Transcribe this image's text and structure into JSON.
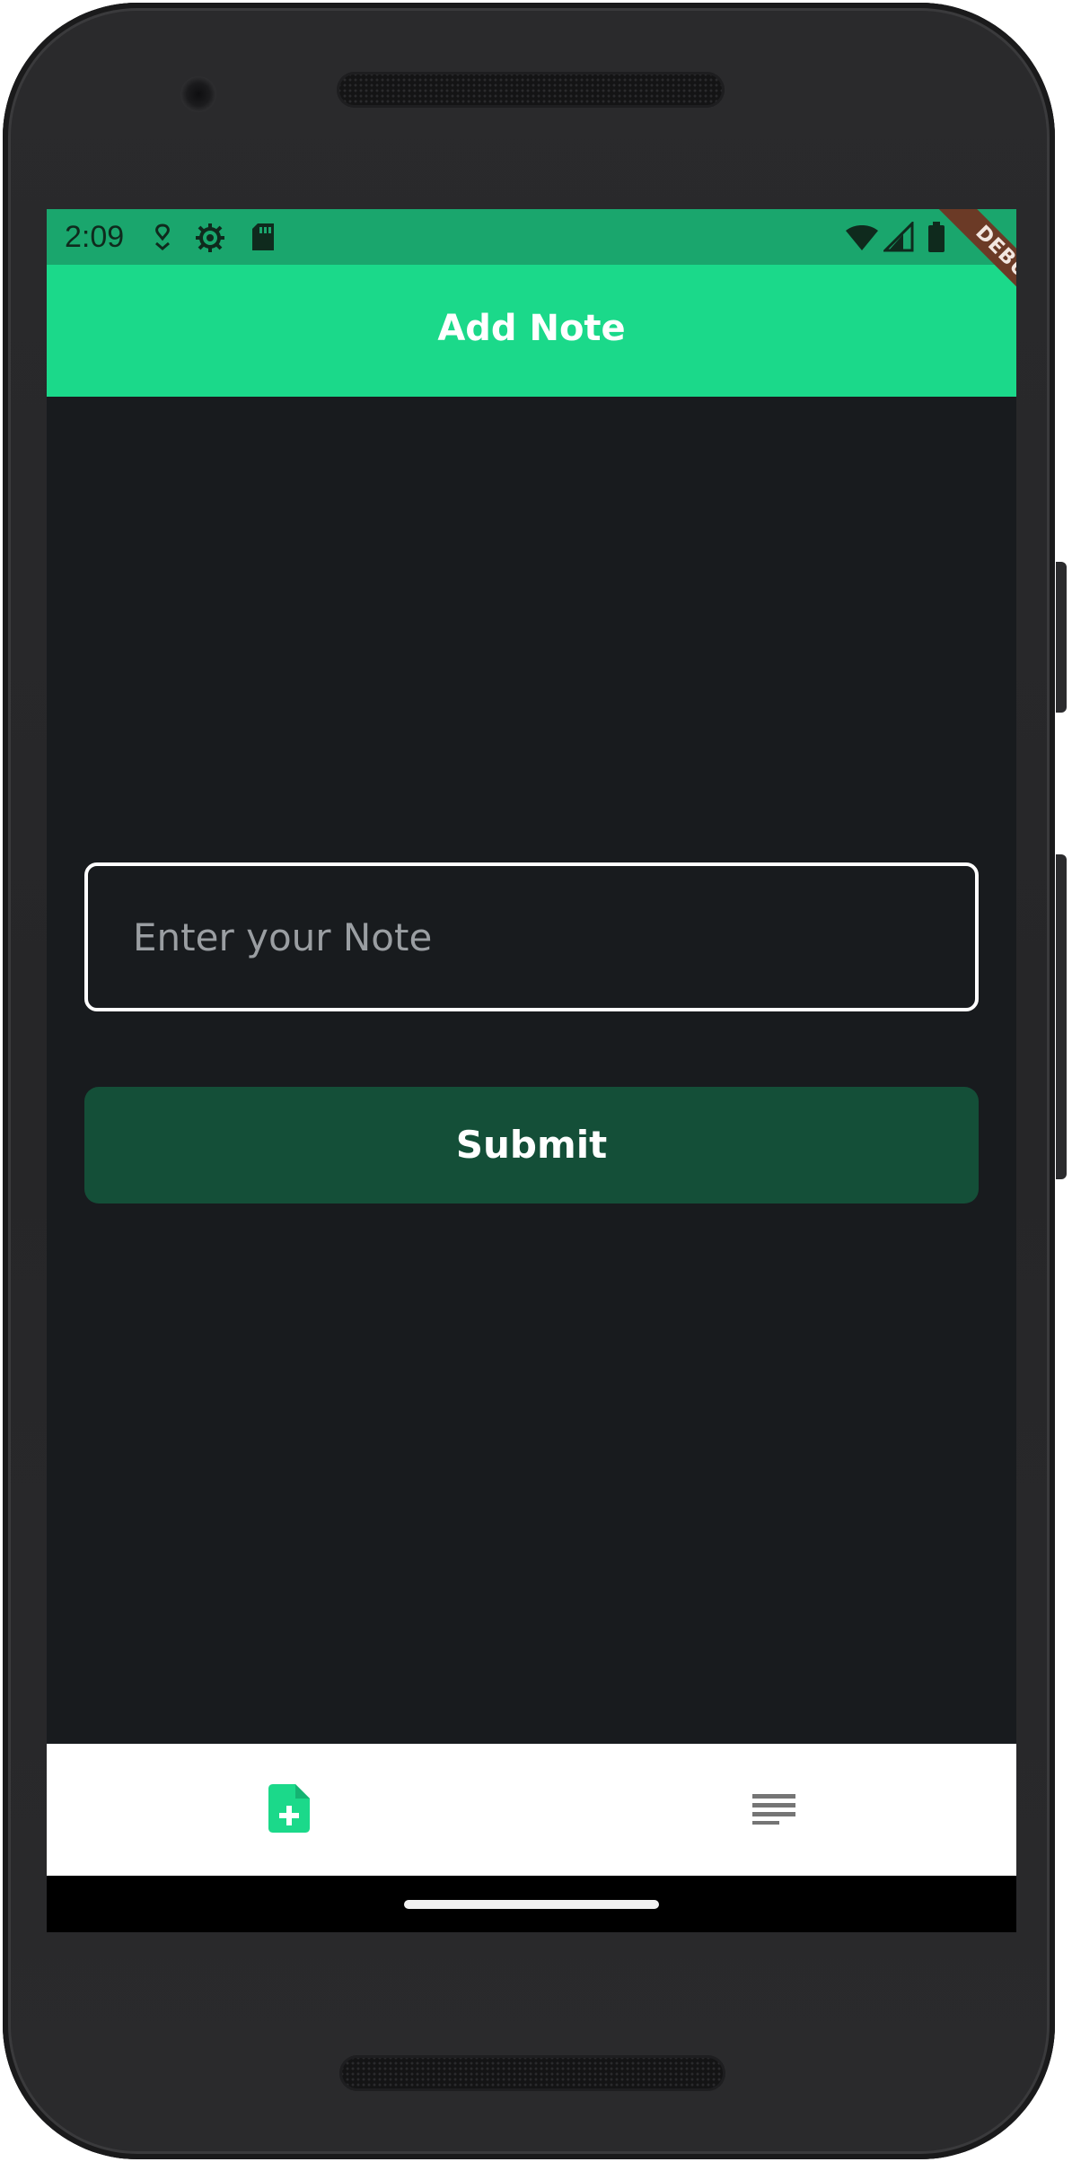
{
  "status_bar": {
    "time": "2:09",
    "icons_left": [
      "location-icon",
      "settings-icon",
      "sd-card-icon"
    ],
    "icons_right": [
      "wifi-icon",
      "signal-icon",
      "battery-icon"
    ]
  },
  "app_bar": {
    "title": "Add Note",
    "debug_label": "DEBUG"
  },
  "form": {
    "note_placeholder": "Enter your Note",
    "note_value": "",
    "submit_label": "Submit"
  },
  "bottom_nav": {
    "items": [
      {
        "icon": "add-note-icon",
        "active": true
      },
      {
        "icon": "notes-list-icon",
        "active": false
      }
    ]
  },
  "colors": {
    "accent": "#1bd98a",
    "status_bar": "#1aa66d",
    "background": "#181b1e",
    "submit_button": "#144f38",
    "inactive_icon": "#757575"
  }
}
